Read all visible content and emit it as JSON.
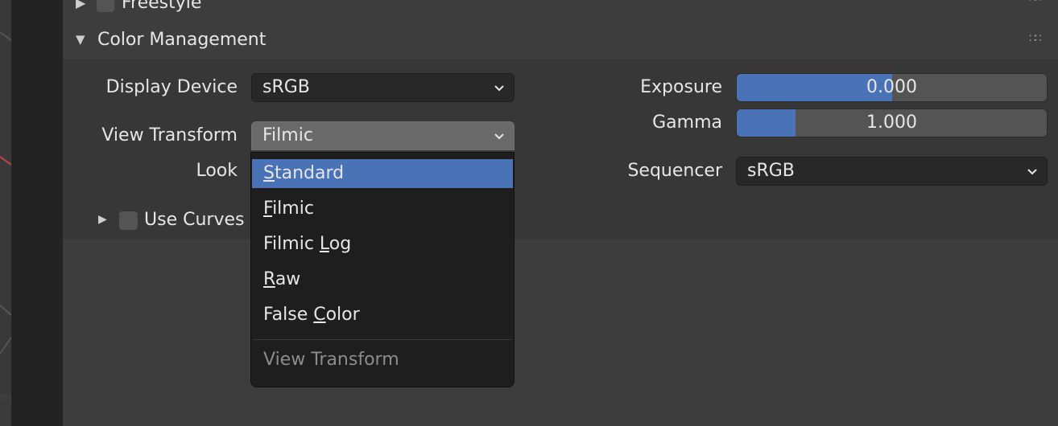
{
  "panels": {
    "freestyle": {
      "label": "Freestyle"
    },
    "color_management": {
      "label": "Color Management",
      "display_device": {
        "label": "Display Device",
        "value": "sRGB"
      },
      "view_transform": {
        "label": "View Transform",
        "value": "Filmic"
      },
      "look": {
        "label": "Look"
      },
      "use_curves": {
        "label": "Use Curves"
      },
      "exposure": {
        "label": "Exposure",
        "value": "0.000",
        "fill": 0.5
      },
      "gamma": {
        "label": "Gamma",
        "value": "1.000",
        "fill": 0.19
      },
      "sequencer": {
        "label": "Sequencer",
        "value": "sRGB"
      }
    }
  },
  "dropdown": {
    "items": [
      {
        "label": "Standard",
        "mnemonic": "S",
        "rest": "tandard",
        "active": true
      },
      {
        "label": "Filmic",
        "mnemonic": "F",
        "rest": "ilmic",
        "active": false
      },
      {
        "label": "Filmic Log",
        "pre": "Filmic ",
        "mnemonic": "L",
        "rest": "og",
        "active": false
      },
      {
        "label": "Raw",
        "mnemonic": "R",
        "rest": "aw",
        "active": false
      },
      {
        "label": "False Color",
        "pre": "False ",
        "mnemonic": "C",
        "rest": "olor",
        "active": false
      }
    ],
    "title": "View Transform"
  },
  "colors": {
    "accent": "#4a72b6",
    "panel_bg": "#3d3d3d",
    "body_bg": "#373737",
    "menu_bg": "#1e1e1e"
  },
  "icons": [
    "disclosure-triangle-icon",
    "checkbox-icon",
    "chevron-down-icon",
    "drag-handle-icon"
  ]
}
